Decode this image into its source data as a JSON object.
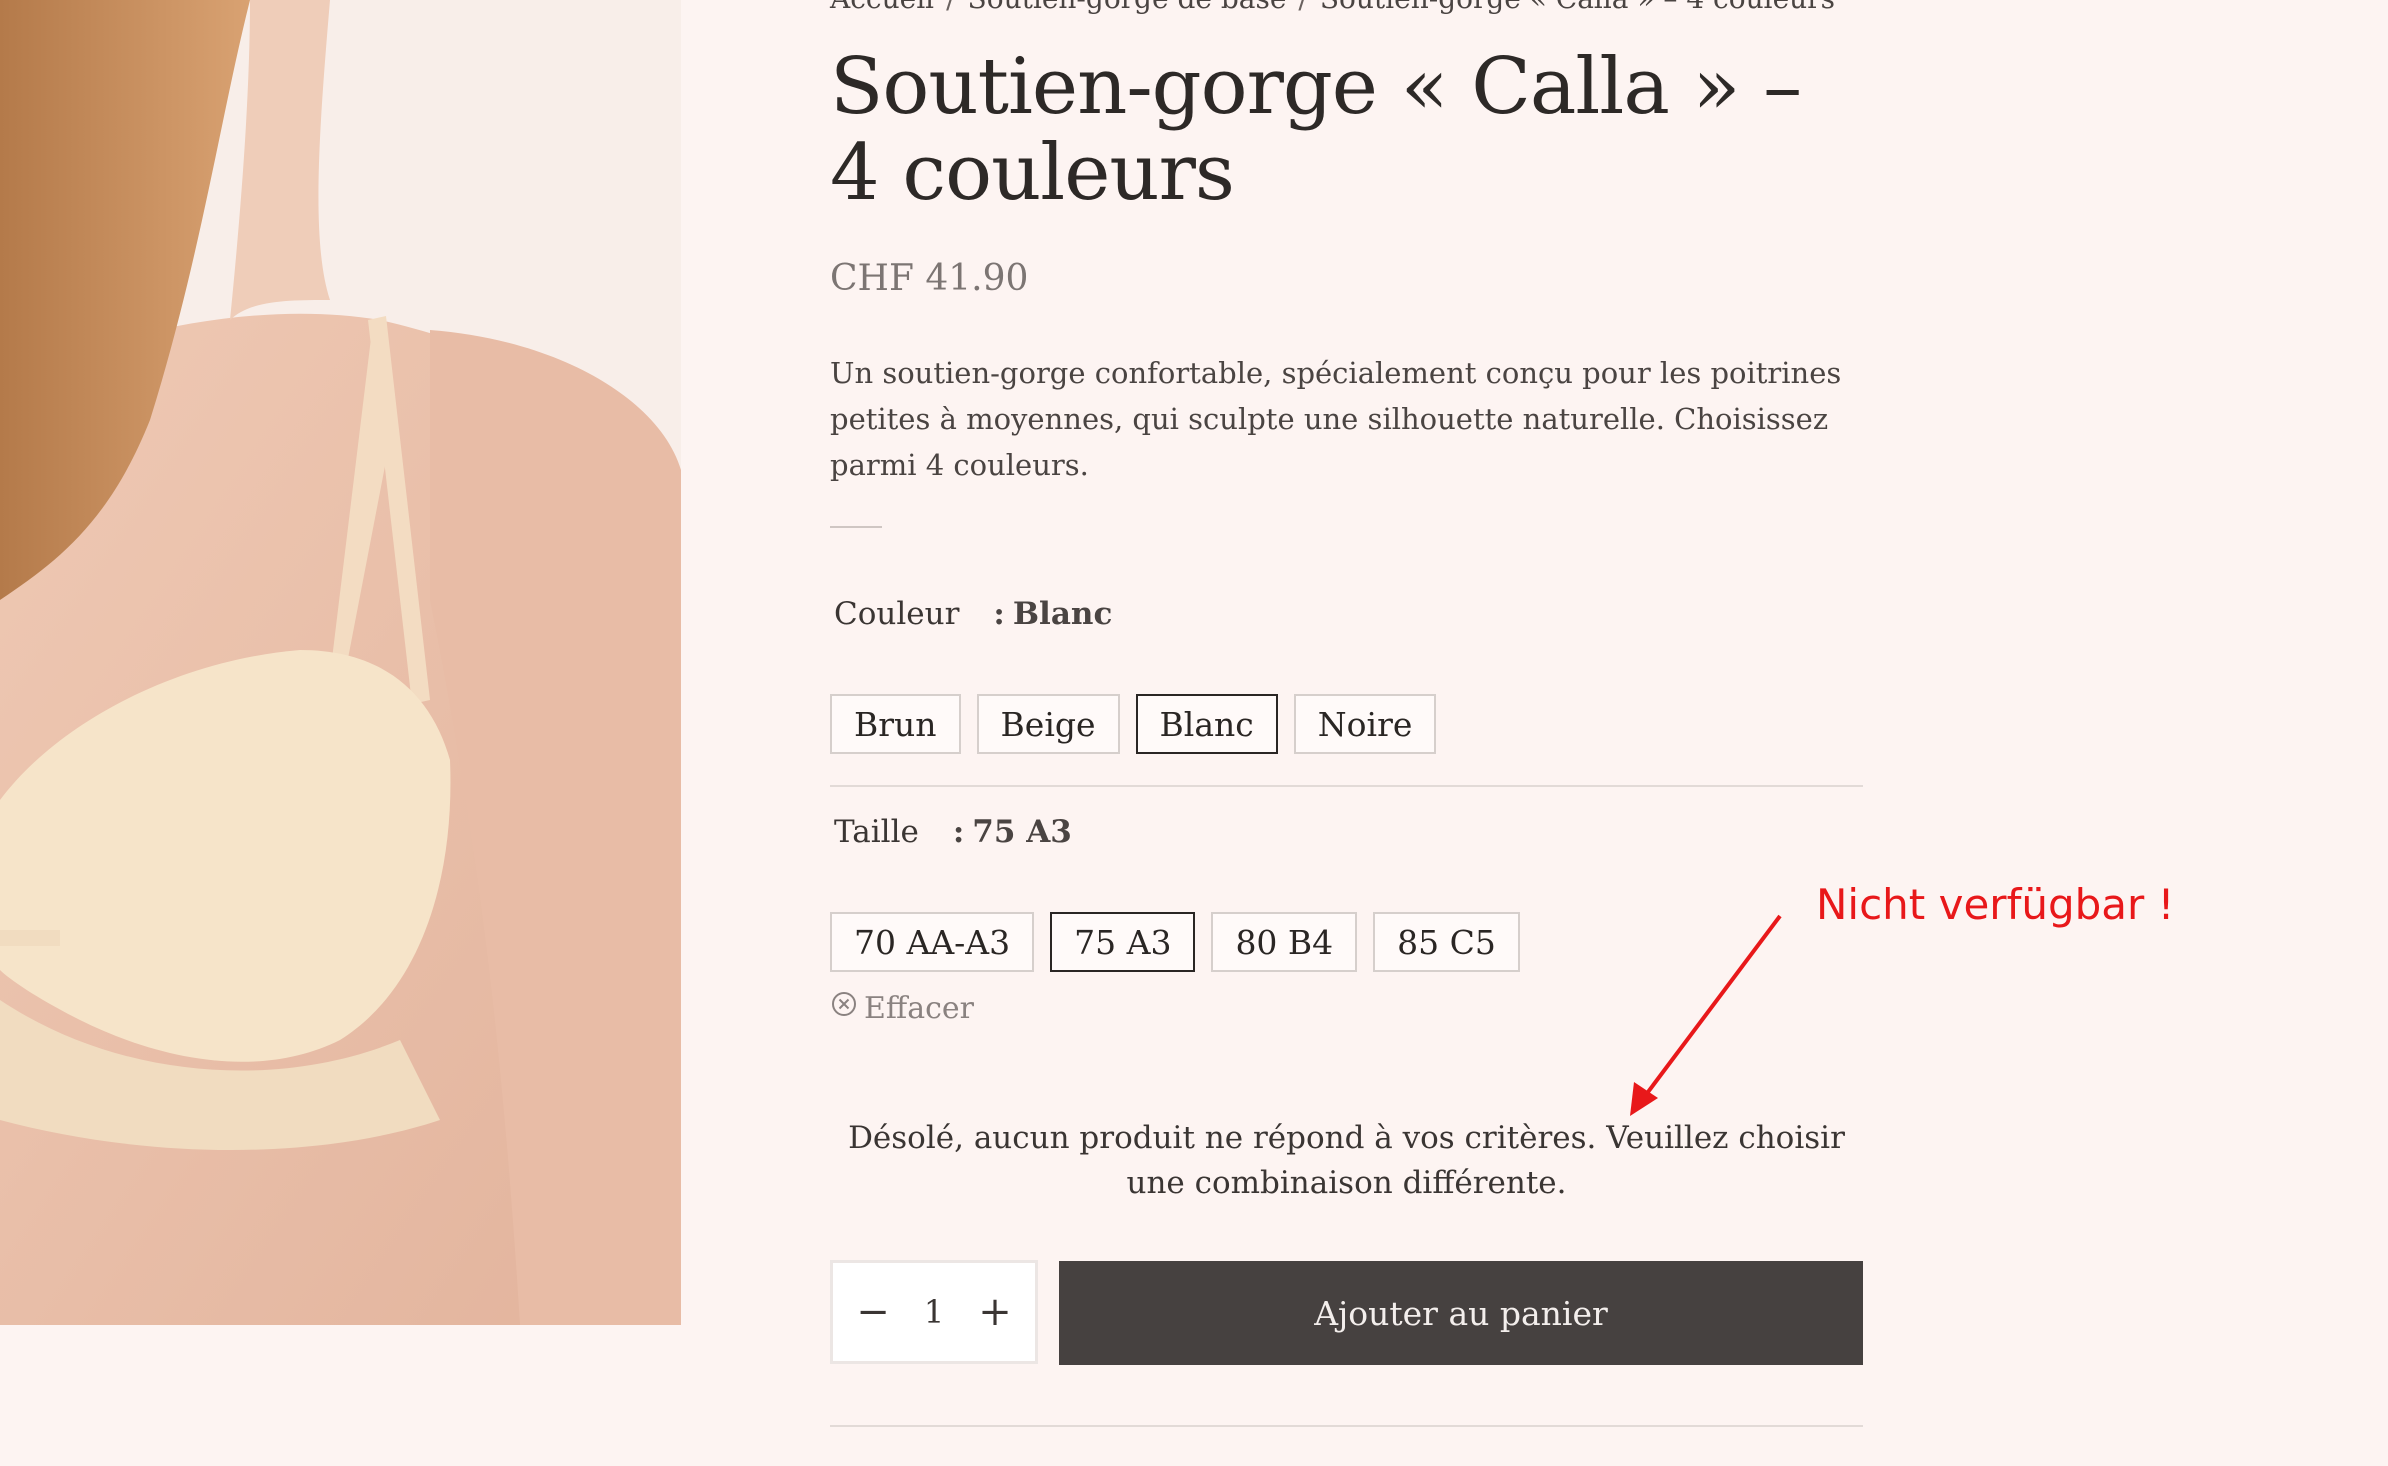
{
  "breadcrumb": {
    "items": [
      "Accueil",
      "Soutien-gorge de base",
      "Soutien-gorge « Calla » – 4 couleurs"
    ]
  },
  "product": {
    "title": "Soutien-gorge « Calla » – 4 couleurs",
    "price": "CHF 41.90",
    "description": "Un soutien-gorge confortable, spécialement conçu pour les poitrines petites à moyennes, qui sculpte une silhouette naturelle. Choisissez parmi 4 couleurs."
  },
  "color": {
    "label": "Couleur",
    "colon": ":",
    "selected": "Blanc",
    "options": [
      "Brun",
      "Beige",
      "Blanc",
      "Noire"
    ]
  },
  "size": {
    "label": "Taille",
    "colon": ":",
    "selected": "75 A3",
    "options": [
      "70 AA-A3",
      "75 A3",
      "80 B4",
      "85 C5"
    ]
  },
  "clear_label": "Effacer",
  "unavailable_message": "Désolé, aucun produit ne répond à vos critères. Veuillez choisir une combinaison différente.",
  "quantity": {
    "minus": "−",
    "value": "1",
    "plus": "+"
  },
  "add_to_cart_label": "Ajouter au panier",
  "annotation": {
    "text": "Nicht verfügbar !",
    "color": "#e8181a"
  },
  "colors": {
    "background": "#fdf4f2",
    "button": "#464140",
    "selected_border": "#2a2624"
  }
}
